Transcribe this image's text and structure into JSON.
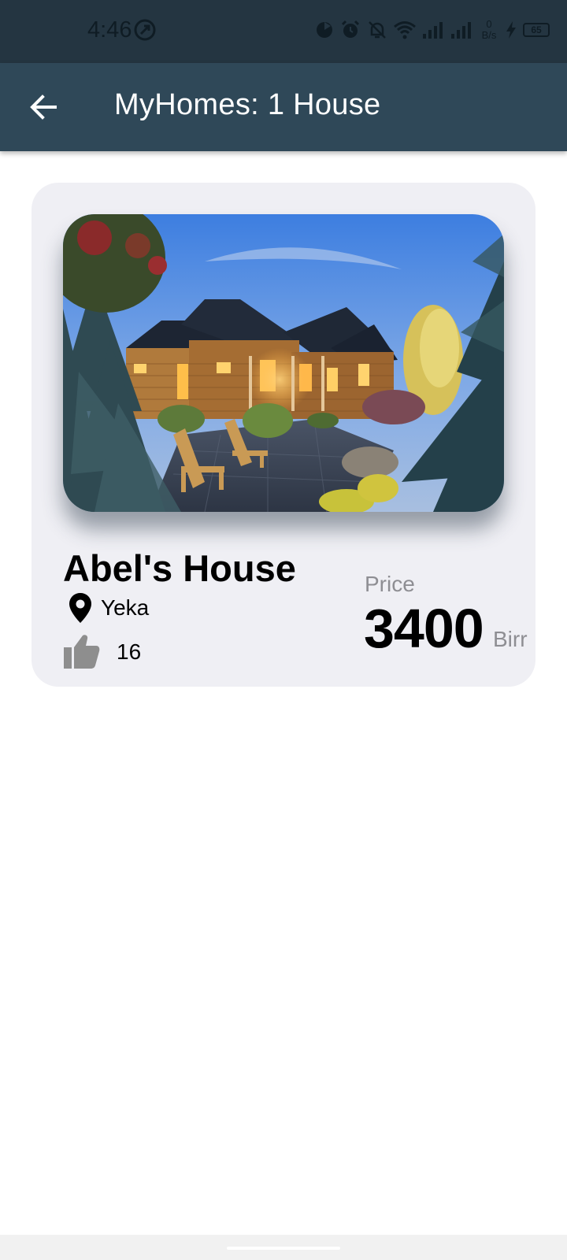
{
  "status_bar": {
    "time": "4:46",
    "net_speed_value": "0",
    "net_speed_unit": "B/s",
    "battery": "65",
    "icons": [
      "data-saver-icon",
      "alarm-icon",
      "notifications-off-icon",
      "wifi-icon",
      "signal-icon",
      "signal-icon",
      "charging-icon",
      "battery-icon"
    ]
  },
  "app_bar": {
    "title": "MyHomes: 1 House",
    "back_icon": "arrow-back-icon",
    "background": "#2f4858"
  },
  "house": {
    "name": "Abel's House",
    "location": "Yeka",
    "likes": "16",
    "price_label": "Price",
    "price": "3400",
    "currency": "Birr",
    "image": "house-photo"
  },
  "colors": {
    "status_bar": "#243541",
    "card_background": "#efeff4",
    "muted_text": "#8e8e93",
    "like_icon": "#8e8e8e"
  }
}
